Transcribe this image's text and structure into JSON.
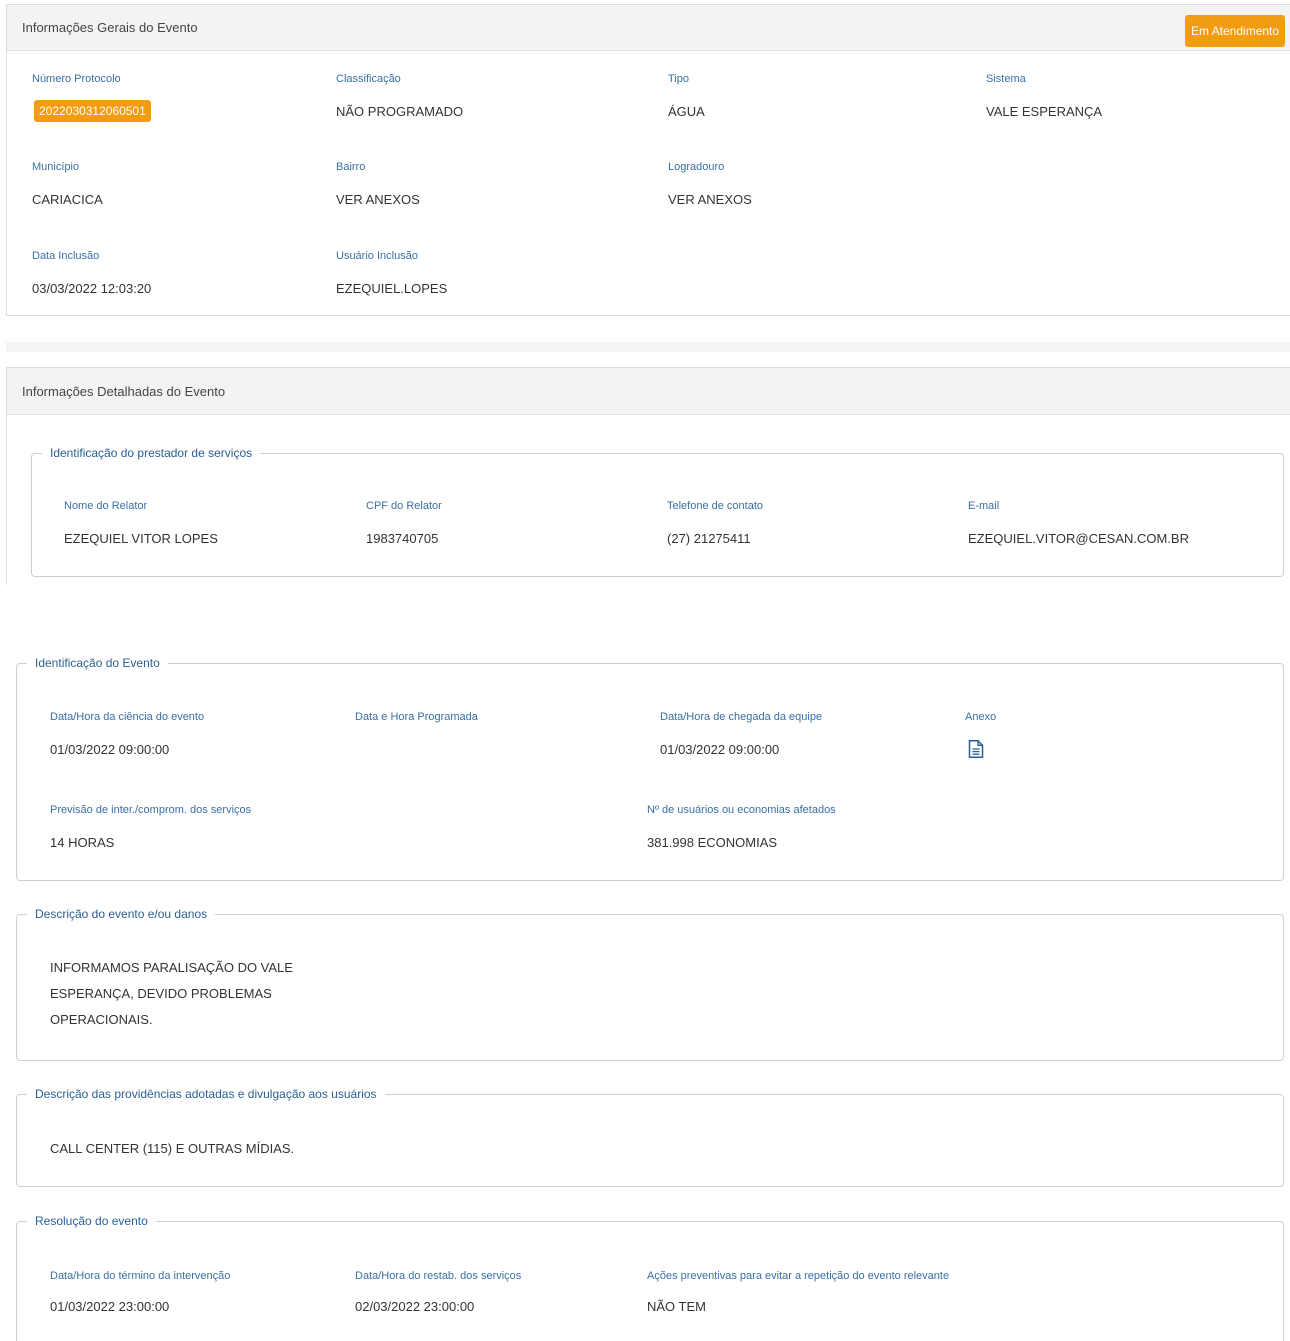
{
  "general": {
    "title": "Informações Gerais do Evento",
    "status": "Em Atendimento",
    "protocol_label": "Número Protocolo",
    "protocol_value": "2022030312060501",
    "classificacao_label": "Classificação",
    "classificacao_value": "NÃO PROGRAMADO",
    "tipo_label": "Tipo",
    "tipo_value": "ÁGUA",
    "sistema_label": "Sistema",
    "sistema_value": "VALE ESPERANÇA",
    "municipio_label": "Município",
    "municipio_value": "CARIACICA",
    "bairro_label": "Bairro",
    "bairro_value": "VER ANEXOS",
    "logradouro_label": "Logradouro",
    "logradouro_value": "VER ANEXOS",
    "data_inclusao_label": "Data Inclusão",
    "data_inclusao_value": "03/03/2022 12:03:20",
    "usuario_inclusao_label": "Usuário Inclusão",
    "usuario_inclusao_value": "EZEQUIEL.LOPES"
  },
  "detailed": {
    "title": "Informações Detalhadas do Evento",
    "prestador": {
      "legend": "Identificação do prestador de serviços",
      "nome_label": "Nome do Relator",
      "nome_value": "EZEQUIEL VITOR LOPES",
      "cpf_label": "CPF do Relator",
      "cpf_value": "1983740705",
      "telefone_label": "Telefone de contato",
      "telefone_value": "(27) 21275411",
      "email_label": "E-mail",
      "email_value": "EZEQUIEL.VITOR@CESAN.COM.BR"
    },
    "evento": {
      "legend": "Identificação do Evento",
      "ciencia_label": "Data/Hora da ciência do evento",
      "ciencia_value": "01/03/2022 09:00:00",
      "programada_label": "Data e Hora Programada",
      "chegada_label": "Data/Hora de chegada da equipe",
      "chegada_value": "01/03/2022 09:00:00",
      "anexo_label": "Anexo",
      "anexo_icon": "document-icon",
      "previsao_label": "Previsão de inter./comprom. dos serviços",
      "previsao_value": "14 HORAS",
      "usuarios_label": "Nº de usuários ou economias afetados",
      "usuarios_value": "381.998 ECONOMIAS"
    },
    "descricao": {
      "legend": "Descrição do evento e/ou danos",
      "text": "INFORMAMOS PARALISAÇÃO DO VALE\nESPERANÇA, DEVIDO PROBLEMAS\nOPERACIONAIS."
    },
    "providencias": {
      "legend": "Descrição das providências adotadas e divulgação aos usuários",
      "text": "CALL CENTER (115) E OUTRAS MÍDIAS."
    },
    "resolucao": {
      "legend": "Resolução do evento",
      "termino_label": "Data/Hora do término da intervenção",
      "termino_value": "01/03/2022 23:00:00",
      "restab_label": "Data/Hora do restab. dos serviços",
      "restab_value": "02/03/2022 23:00:00",
      "acoes_label": "Ações preventivas para evitar a repetição do evento relevante",
      "acoes_value": "NÃO TEM"
    }
  },
  "colors": {
    "accent": "#f39c12",
    "label": "#3a6fa5",
    "legend": "#2b5f93"
  }
}
